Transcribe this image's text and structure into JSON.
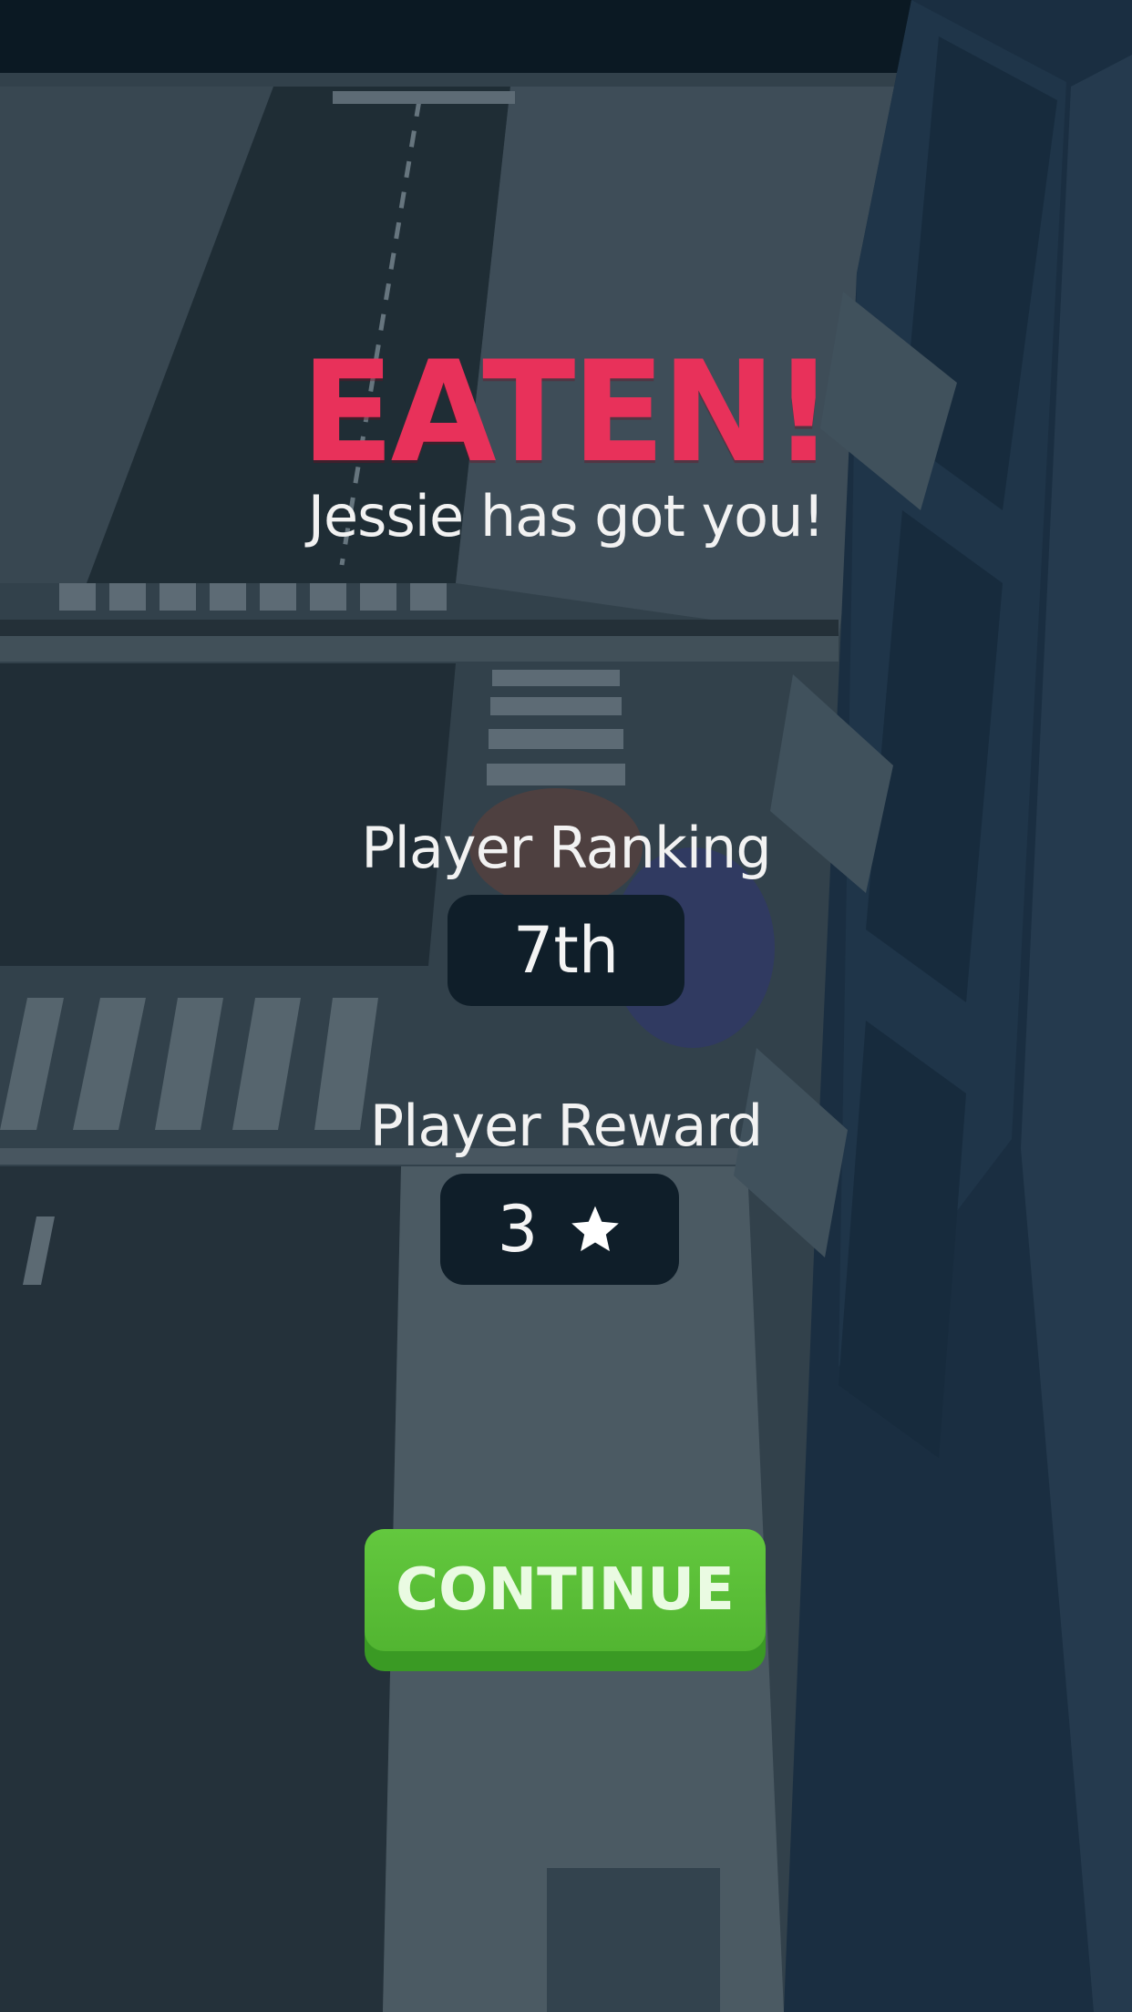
{
  "result": {
    "title": "EATEN!",
    "subtitle": "Jessie has got you!"
  },
  "ranking": {
    "label": "Player Ranking",
    "value": "7th"
  },
  "reward": {
    "label": "Player Reward",
    "value": "3",
    "icon": "star-icon"
  },
  "continue_button": {
    "label": "CONTINUE"
  },
  "colors": {
    "title": "#e8315a",
    "button": "#58b936",
    "pill": "#0f1e29"
  }
}
